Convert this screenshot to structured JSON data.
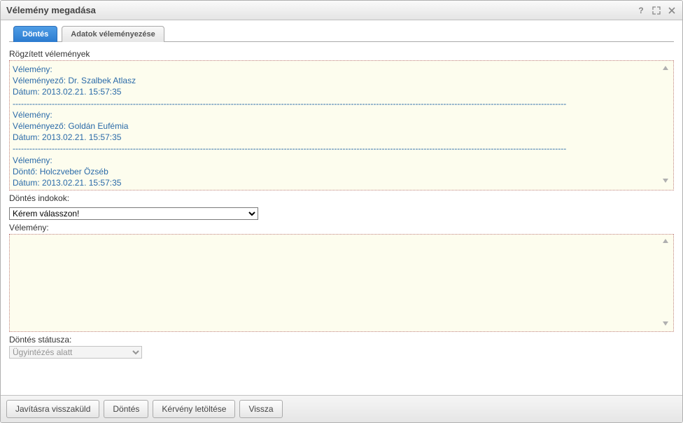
{
  "window": {
    "title": "Vélemény megadása"
  },
  "tabs": {
    "active": "Döntés",
    "other": "Adatok véleményezése"
  },
  "labels": {
    "recorded_opinions": "Rögzített vélemények",
    "decision_reasons": "Döntés indokok:",
    "opinion": "Vélemény:",
    "decision_status": "Döntés státusza:"
  },
  "opinions": [
    {
      "velemeny_label": "Vélemény:",
      "role_label": "Véleményező: ",
      "person": "Dr. Szalbek Atlasz",
      "date_label": "Dátum: ",
      "date": "2013.02.21. 15:57:35"
    },
    {
      "velemeny_label": "Vélemény:",
      "role_label": "Véleményező: ",
      "person": "Goldán Eufémia",
      "date_label": "Dátum: ",
      "date": "2013.02.21. 15:57:35"
    },
    {
      "velemeny_label": "Vélemény:",
      "role_label": "Döntő: ",
      "person": "Holczveber Özséb",
      "date_label": "Dátum: ",
      "date": "2013.02.21. 15:57:35"
    }
  ],
  "dashes": "------------------------------------------------------------------------------------------------------------------------------------------------------------------------------------------------------",
  "decision_reason_select": {
    "placeholder": "Kérem válasszon!"
  },
  "opinion_textarea": {
    "value": ""
  },
  "status_select": {
    "value": "Ügyintézés alatt"
  },
  "buttons": {
    "return_for_fix": "Javításra visszaküld",
    "decision": "Döntés",
    "download": "Kérvény letöltése",
    "back": "Vissza"
  }
}
